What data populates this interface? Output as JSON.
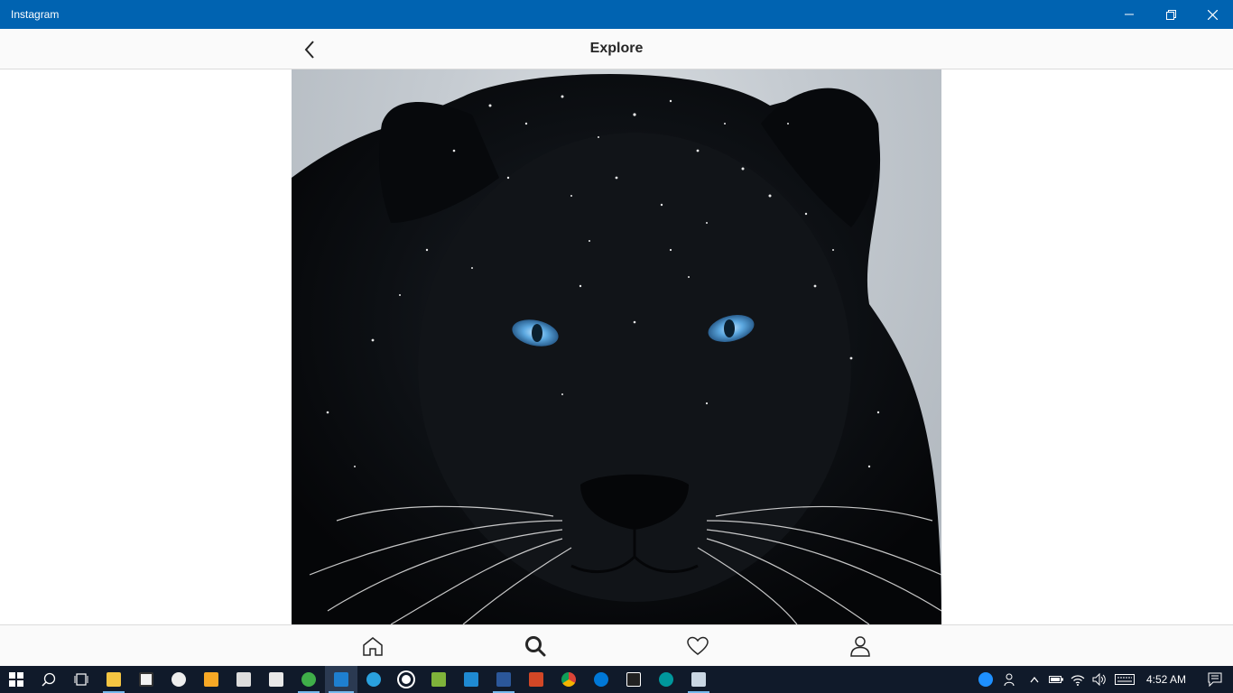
{
  "window": {
    "title": "Instagram"
  },
  "header": {
    "title": "Explore"
  },
  "photo": {
    "subject": "black-panther-photo"
  },
  "bottom_nav": {
    "items": [
      {
        "name": "home-icon"
      },
      {
        "name": "search-icon",
        "active": true
      },
      {
        "name": "heart-icon"
      },
      {
        "name": "profile-icon"
      }
    ]
  },
  "taskbar": {
    "clock": "4:52 AM",
    "apps": [
      "file-explorer",
      "store",
      "amazon",
      "media-player",
      "camera",
      "mail",
      "app-green",
      "instagram",
      "telegram",
      "groove",
      "minecraft",
      "vscode",
      "word",
      "powerpoint",
      "chrome",
      "edge",
      "pe-tool",
      "arduino",
      "network-tool"
    ]
  },
  "colors": {
    "titlebar": "#0063b1",
    "taskbar": "#101a2a",
    "accent": "#76b9ed"
  }
}
